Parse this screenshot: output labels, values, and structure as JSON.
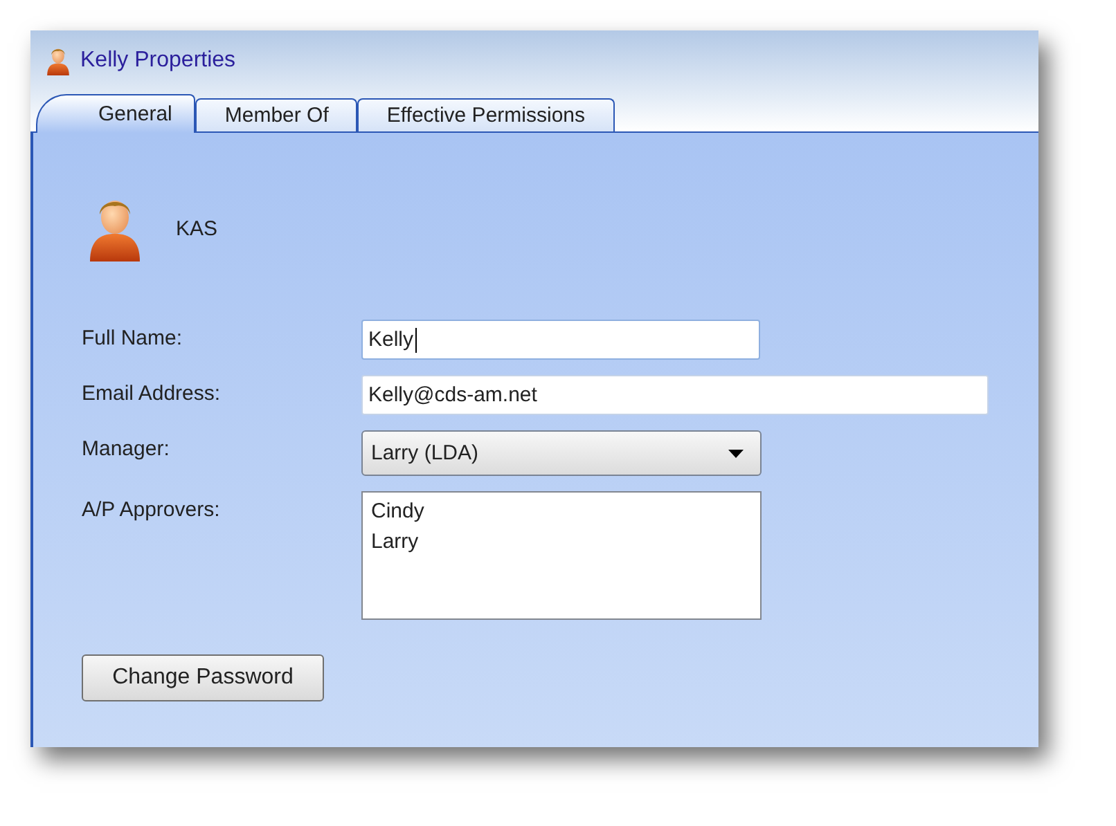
{
  "window": {
    "title": "Kelly Properties"
  },
  "tabs": [
    {
      "label": "General",
      "selected": true
    },
    {
      "label": "Member Of",
      "selected": false
    },
    {
      "label": "Effective Permissions",
      "selected": false
    }
  ],
  "user": {
    "name": "KAS"
  },
  "fields": [
    {
      "kind": "text",
      "label": "Full Name:",
      "value": "Kelly",
      "focused": true
    },
    {
      "kind": "text",
      "label": "Email Address:",
      "value": "Kelly@cds-am.net",
      "focused": false
    },
    {
      "kind": "dropdown",
      "label": "Manager:",
      "value": "Larry (LDA)"
    },
    {
      "kind": "list",
      "label": "A/P Approvers:",
      "items": [
        "Cindy",
        "Larry"
      ]
    }
  ],
  "buttons": [
    "Change Password"
  ]
}
